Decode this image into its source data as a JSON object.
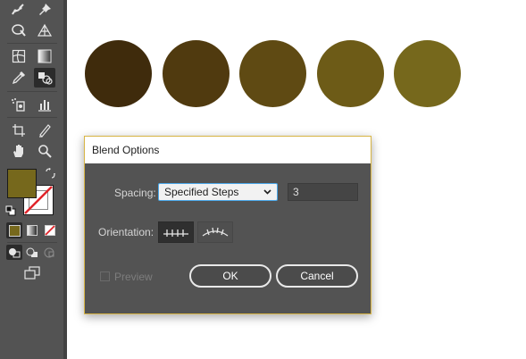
{
  "canvas": {
    "circle_colors": [
      "#3f2b0c",
      "#503a0f",
      "#5f4a13",
      "#6d5b17",
      "#76681c"
    ]
  },
  "toolbar": {
    "fill_color": "#76681c",
    "icons": [
      "puppet-warp-icon",
      "pin-icon",
      "shape-builder-icon",
      "perspective-grid-icon",
      "mesh-icon",
      "gradient-icon",
      "eyedropper-icon",
      "blend-icon",
      "symbol-sprayer-icon",
      "column-graph-icon",
      "artboard-icon",
      "slice-icon",
      "hand-icon",
      "zoom-icon",
      "swap-colors-icon",
      "default-colors-icon",
      "color-icon",
      "gradient-swatch-icon",
      "none-icon",
      "draw-normal-icon",
      "draw-behind-icon",
      "draw-inside-icon",
      "change-screen-mode-icon"
    ]
  },
  "dialog": {
    "title": "Blend Options",
    "spacing_label": "Spacing:",
    "spacing_value": "Specified Steps",
    "steps_value": "3",
    "orientation_label": "Orientation:",
    "preview_label": "Preview",
    "ok_label": "OK",
    "cancel_label": "Cancel",
    "border_color": "#d8b545"
  }
}
